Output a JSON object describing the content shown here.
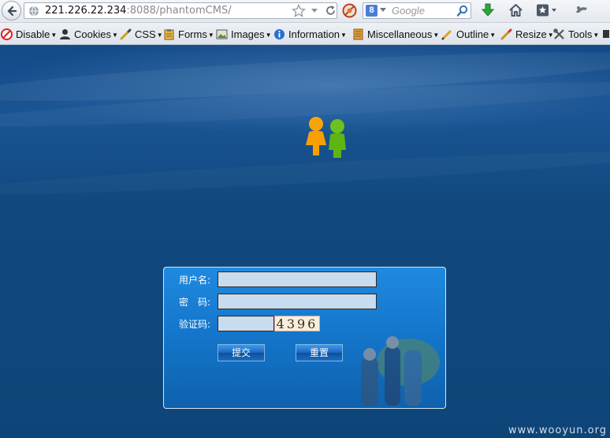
{
  "browser": {
    "url_host": "221.226.22.234",
    "url_rest": ":8088/phantomCMS/",
    "search_placeholder": "Google",
    "search_engine_letter": "8"
  },
  "devtoolbar": {
    "items": [
      {
        "label": "Disable",
        "icon": "disable-icon"
      },
      {
        "label": "Cookies",
        "icon": "cookies-icon"
      },
      {
        "label": "CSS",
        "icon": "css-icon"
      },
      {
        "label": "Forms",
        "icon": "forms-icon"
      },
      {
        "label": "Images",
        "icon": "images-icon"
      },
      {
        "label": "Information",
        "icon": "information-icon"
      },
      {
        "label": "Miscellaneous",
        "icon": "miscellaneous-icon"
      },
      {
        "label": "Outline",
        "icon": "outline-icon"
      },
      {
        "label": "Resize",
        "icon": "resize-icon"
      },
      {
        "label": "Tools",
        "icon": "tools-icon"
      }
    ]
  },
  "login": {
    "username_label": "用户名:",
    "password_label": "密　码:",
    "captcha_label": "验证码:",
    "username_value": "",
    "password_value": "",
    "captcha_value": "",
    "captcha_code": "4396",
    "submit_label": "提交",
    "reset_label": "重置"
  },
  "watermark": "www.wooyun.org",
  "colors": {
    "page_bg": "#11497f",
    "panel_bg": "#1477cc",
    "input_bg": "#c7dcef"
  }
}
